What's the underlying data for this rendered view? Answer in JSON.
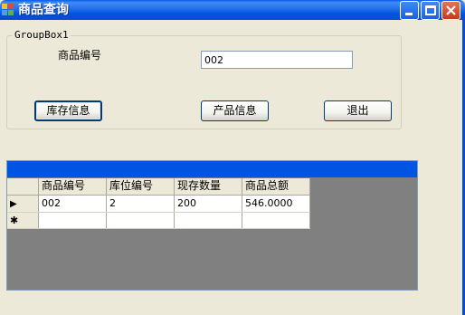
{
  "window": {
    "title": "商品查询",
    "icon": "window-app-icon"
  },
  "titlebar_buttons": {
    "minimize_icon": "minimize-icon",
    "maximize_icon": "maximize-icon",
    "close_icon": "close-icon"
  },
  "groupbox": {
    "legend": "GroupBox1",
    "product_code_label": "商品编号",
    "product_code_value": "002"
  },
  "buttons": {
    "inventory_info": "库存信息",
    "product_info": "产品信息",
    "exit": "退出"
  },
  "grid": {
    "caption_color": "#0054E3",
    "columns": [
      "商品编号",
      "库位编号",
      "现存数量",
      "商品总额"
    ],
    "rows": [
      [
        "002",
        "2",
        "200",
        "546.0000"
      ]
    ],
    "current_row_marker": "▶",
    "new_row_marker": "✱"
  },
  "colors": {
    "titlebar": "#0054E3",
    "window_bg": "#ECE9D8",
    "grid_bg": "#808080"
  }
}
